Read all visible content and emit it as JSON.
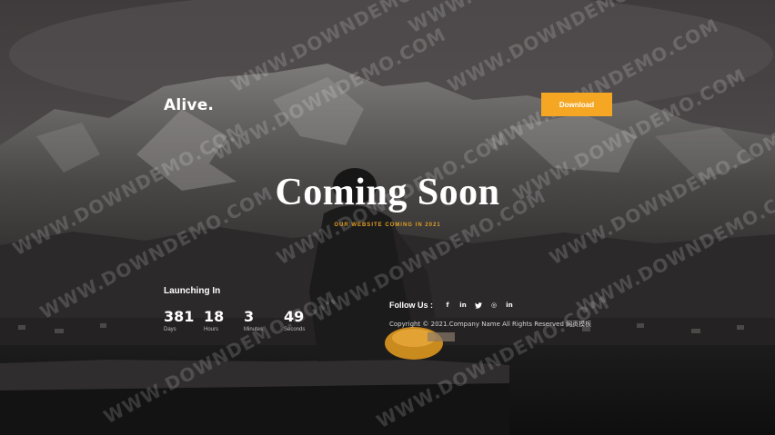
{
  "brand": {
    "logo": "Alive."
  },
  "header": {
    "download_label": "Download"
  },
  "hero": {
    "title": "Coming Soon",
    "tagline": "OUR WEBSITE COMING IN 2021"
  },
  "countdown": {
    "title": "Launching In",
    "units": [
      {
        "value": "381",
        "label": "Days"
      },
      {
        "value": "18",
        "label": "Hours"
      },
      {
        "value": "3",
        "label": "Minutes"
      },
      {
        "value": "49",
        "label": "Seconds"
      }
    ]
  },
  "footer": {
    "follow_label": "Follow Us :",
    "social": [
      {
        "icon": "facebook-icon",
        "glyph": "f"
      },
      {
        "icon": "linkedin-icon",
        "glyph": "in"
      },
      {
        "icon": "twitter-icon",
        "glyph": "t"
      },
      {
        "icon": "instagram-icon",
        "glyph": "◎"
      },
      {
        "icon": "linkedin-icon",
        "glyph": "in"
      }
    ],
    "copyright": "Copyright © 2021.Company Name All Rights Reserved 网页模板"
  },
  "watermark": "WWW.DOWNDEMO.COM",
  "colors": {
    "accent": "#f5a623",
    "tagline": "#e0a024",
    "text": "#ffffff"
  }
}
